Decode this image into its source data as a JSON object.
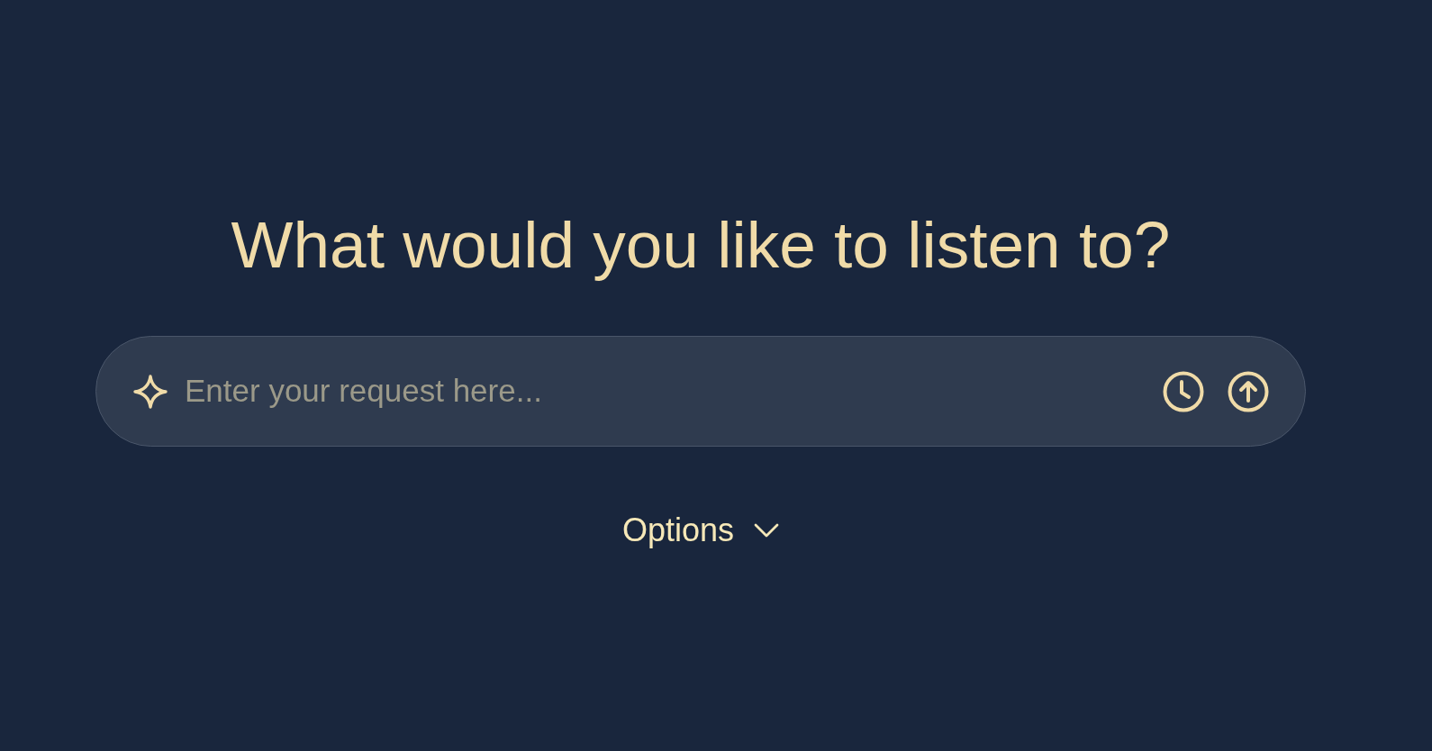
{
  "heading": "What would you like to listen to?",
  "request_field": {
    "placeholder": "Enter your request here..."
  },
  "options_toggle": {
    "label": "Options",
    "expanded": false
  }
}
